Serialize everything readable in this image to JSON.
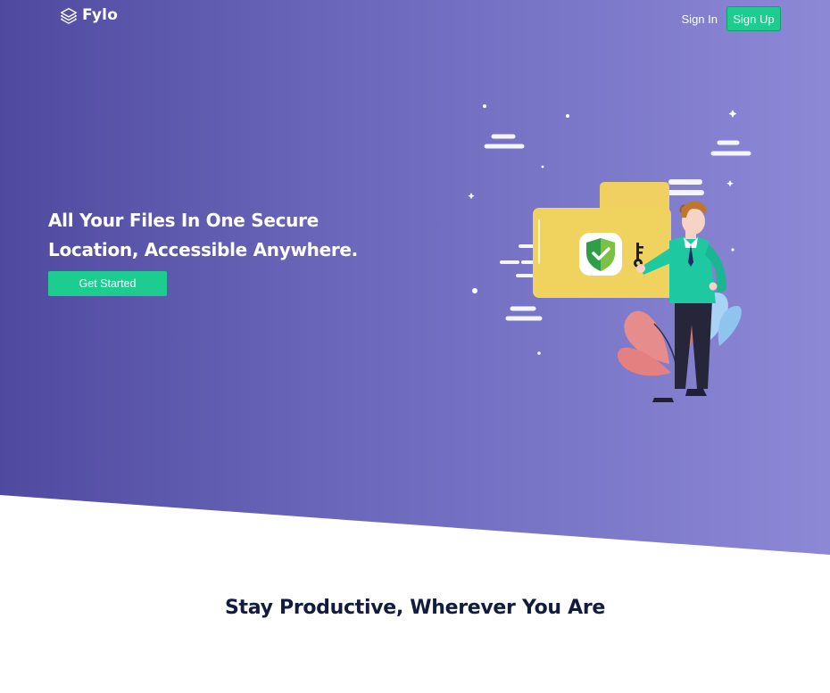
{
  "header": {
    "brand": "Fylo",
    "logo_icon": "layers-icon",
    "nav": {
      "sign_in": "Sign In",
      "sign_up": "Sign Up"
    }
  },
  "hero": {
    "headline": "All Your Files In One Secure Location, Accessible Anywhere.",
    "cta_label": "Get Started",
    "illustration": "man-with-key-and-secure-folder"
  },
  "features": {
    "title": "Stay Productive, Wherever You Are"
  },
  "colors": {
    "hero_gradient_start": "#4f4a9f",
    "hero_gradient_end": "#8d88d6",
    "accent": "#1dcc8f",
    "heading_dark": "#131c3e"
  }
}
